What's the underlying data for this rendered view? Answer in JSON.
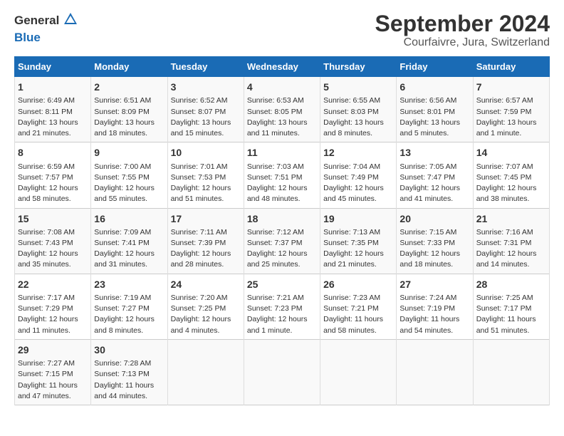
{
  "header": {
    "logo_line1": "General",
    "logo_line2": "Blue",
    "main_title": "September 2024",
    "subtitle": "Courfaivre, Jura, Switzerland"
  },
  "days_of_week": [
    "Sunday",
    "Monday",
    "Tuesday",
    "Wednesday",
    "Thursday",
    "Friday",
    "Saturday"
  ],
  "weeks": [
    [
      {
        "day": "1",
        "sunrise": "Sunrise: 6:49 AM",
        "sunset": "Sunset: 8:11 PM",
        "daylight": "Daylight: 13 hours and 21 minutes."
      },
      {
        "day": "2",
        "sunrise": "Sunrise: 6:51 AM",
        "sunset": "Sunset: 8:09 PM",
        "daylight": "Daylight: 13 hours and 18 minutes."
      },
      {
        "day": "3",
        "sunrise": "Sunrise: 6:52 AM",
        "sunset": "Sunset: 8:07 PM",
        "daylight": "Daylight: 13 hours and 15 minutes."
      },
      {
        "day": "4",
        "sunrise": "Sunrise: 6:53 AM",
        "sunset": "Sunset: 8:05 PM",
        "daylight": "Daylight: 13 hours and 11 minutes."
      },
      {
        "day": "5",
        "sunrise": "Sunrise: 6:55 AM",
        "sunset": "Sunset: 8:03 PM",
        "daylight": "Daylight: 13 hours and 8 minutes."
      },
      {
        "day": "6",
        "sunrise": "Sunrise: 6:56 AM",
        "sunset": "Sunset: 8:01 PM",
        "daylight": "Daylight: 13 hours and 5 minutes."
      },
      {
        "day": "7",
        "sunrise": "Sunrise: 6:57 AM",
        "sunset": "Sunset: 7:59 PM",
        "daylight": "Daylight: 13 hours and 1 minute."
      }
    ],
    [
      {
        "day": "8",
        "sunrise": "Sunrise: 6:59 AM",
        "sunset": "Sunset: 7:57 PM",
        "daylight": "Daylight: 12 hours and 58 minutes."
      },
      {
        "day": "9",
        "sunrise": "Sunrise: 7:00 AM",
        "sunset": "Sunset: 7:55 PM",
        "daylight": "Daylight: 12 hours and 55 minutes."
      },
      {
        "day": "10",
        "sunrise": "Sunrise: 7:01 AM",
        "sunset": "Sunset: 7:53 PM",
        "daylight": "Daylight: 12 hours and 51 minutes."
      },
      {
        "day": "11",
        "sunrise": "Sunrise: 7:03 AM",
        "sunset": "Sunset: 7:51 PM",
        "daylight": "Daylight: 12 hours and 48 minutes."
      },
      {
        "day": "12",
        "sunrise": "Sunrise: 7:04 AM",
        "sunset": "Sunset: 7:49 PM",
        "daylight": "Daylight: 12 hours and 45 minutes."
      },
      {
        "day": "13",
        "sunrise": "Sunrise: 7:05 AM",
        "sunset": "Sunset: 7:47 PM",
        "daylight": "Daylight: 12 hours and 41 minutes."
      },
      {
        "day": "14",
        "sunrise": "Sunrise: 7:07 AM",
        "sunset": "Sunset: 7:45 PM",
        "daylight": "Daylight: 12 hours and 38 minutes."
      }
    ],
    [
      {
        "day": "15",
        "sunrise": "Sunrise: 7:08 AM",
        "sunset": "Sunset: 7:43 PM",
        "daylight": "Daylight: 12 hours and 35 minutes."
      },
      {
        "day": "16",
        "sunrise": "Sunrise: 7:09 AM",
        "sunset": "Sunset: 7:41 PM",
        "daylight": "Daylight: 12 hours and 31 minutes."
      },
      {
        "day": "17",
        "sunrise": "Sunrise: 7:11 AM",
        "sunset": "Sunset: 7:39 PM",
        "daylight": "Daylight: 12 hours and 28 minutes."
      },
      {
        "day": "18",
        "sunrise": "Sunrise: 7:12 AM",
        "sunset": "Sunset: 7:37 PM",
        "daylight": "Daylight: 12 hours and 25 minutes."
      },
      {
        "day": "19",
        "sunrise": "Sunrise: 7:13 AM",
        "sunset": "Sunset: 7:35 PM",
        "daylight": "Daylight: 12 hours and 21 minutes."
      },
      {
        "day": "20",
        "sunrise": "Sunrise: 7:15 AM",
        "sunset": "Sunset: 7:33 PM",
        "daylight": "Daylight: 12 hours and 18 minutes."
      },
      {
        "day": "21",
        "sunrise": "Sunrise: 7:16 AM",
        "sunset": "Sunset: 7:31 PM",
        "daylight": "Daylight: 12 hours and 14 minutes."
      }
    ],
    [
      {
        "day": "22",
        "sunrise": "Sunrise: 7:17 AM",
        "sunset": "Sunset: 7:29 PM",
        "daylight": "Daylight: 12 hours and 11 minutes."
      },
      {
        "day": "23",
        "sunrise": "Sunrise: 7:19 AM",
        "sunset": "Sunset: 7:27 PM",
        "daylight": "Daylight: 12 hours and 8 minutes."
      },
      {
        "day": "24",
        "sunrise": "Sunrise: 7:20 AM",
        "sunset": "Sunset: 7:25 PM",
        "daylight": "Daylight: 12 hours and 4 minutes."
      },
      {
        "day": "25",
        "sunrise": "Sunrise: 7:21 AM",
        "sunset": "Sunset: 7:23 PM",
        "daylight": "Daylight: 12 hours and 1 minute."
      },
      {
        "day": "26",
        "sunrise": "Sunrise: 7:23 AM",
        "sunset": "Sunset: 7:21 PM",
        "daylight": "Daylight: 11 hours and 58 minutes."
      },
      {
        "day": "27",
        "sunrise": "Sunrise: 7:24 AM",
        "sunset": "Sunset: 7:19 PM",
        "daylight": "Daylight: 11 hours and 54 minutes."
      },
      {
        "day": "28",
        "sunrise": "Sunrise: 7:25 AM",
        "sunset": "Sunset: 7:17 PM",
        "daylight": "Daylight: 11 hours and 51 minutes."
      }
    ],
    [
      {
        "day": "29",
        "sunrise": "Sunrise: 7:27 AM",
        "sunset": "Sunset: 7:15 PM",
        "daylight": "Daylight: 11 hours and 47 minutes."
      },
      {
        "day": "30",
        "sunrise": "Sunrise: 7:28 AM",
        "sunset": "Sunset: 7:13 PM",
        "daylight": "Daylight: 11 hours and 44 minutes."
      },
      {
        "day": "",
        "sunrise": "",
        "sunset": "",
        "daylight": ""
      },
      {
        "day": "",
        "sunrise": "",
        "sunset": "",
        "daylight": ""
      },
      {
        "day": "",
        "sunrise": "",
        "sunset": "",
        "daylight": ""
      },
      {
        "day": "",
        "sunrise": "",
        "sunset": "",
        "daylight": ""
      },
      {
        "day": "",
        "sunrise": "",
        "sunset": "",
        "daylight": ""
      }
    ]
  ]
}
